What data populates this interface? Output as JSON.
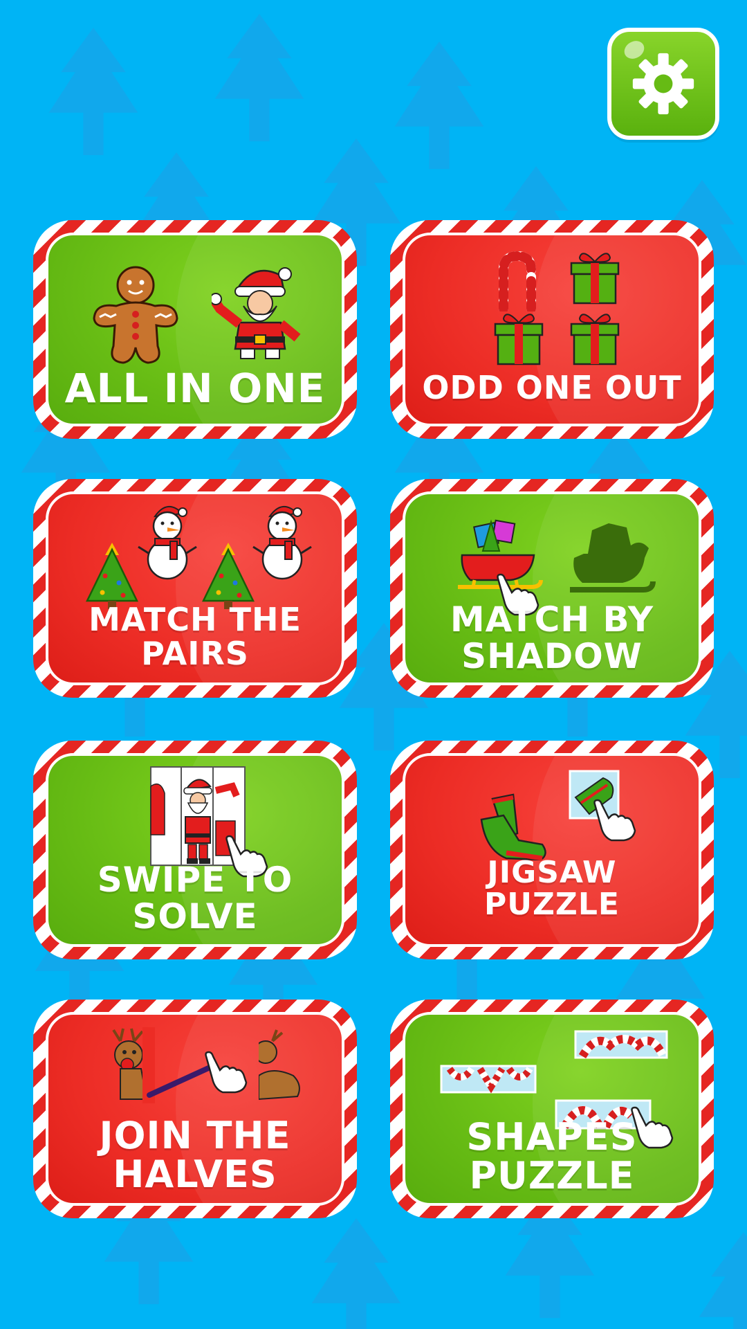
{
  "settings": {
    "icon": "gear-icon",
    "color": "#66bb14"
  },
  "modes": [
    {
      "id": "all-in-one",
      "label": "ALL IN ONE",
      "color": "green",
      "icons": [
        "gingerbread-man-icon",
        "santa-icon"
      ]
    },
    {
      "id": "odd-one-out",
      "label": "ODD ONE OUT",
      "color": "red",
      "icons": [
        "candy-cane-icon",
        "gift-box-icon"
      ]
    },
    {
      "id": "match-the-pairs",
      "label": "MATCH THE PAIRS",
      "color": "red",
      "icons": [
        "christmas-tree-icon",
        "snowman-icon"
      ]
    },
    {
      "id": "match-by-shadow",
      "label": "MATCH BY SHADOW",
      "color": "green",
      "icons": [
        "sleigh-icon",
        "sleigh-shadow-icon",
        "pointing-hand-icon"
      ]
    },
    {
      "id": "swipe-to-solve",
      "label": "SWIPE TO SOLVE",
      "color": "green",
      "icons": [
        "santa-tiles-icon",
        "pointing-hand-icon"
      ]
    },
    {
      "id": "jigsaw-puzzle",
      "label": "JIGSAW PUZZLE",
      "color": "red",
      "icons": [
        "mitten-icon",
        "puzzle-piece-icon",
        "pointing-hand-icon"
      ]
    },
    {
      "id": "join-the-halves",
      "label": "JOIN THE HALVES",
      "color": "red",
      "icons": [
        "reindeer-half-icon",
        "pointing-hand-icon"
      ]
    },
    {
      "id": "shapes-puzzle",
      "label": "SHAPES PUZZLE",
      "color": "green",
      "icons": [
        "candy-cane-shapes-icon",
        "pointing-hand-icon"
      ]
    }
  ],
  "colors": {
    "background": "#00b4f5",
    "green": "#66bb14",
    "red": "#ec2c25",
    "stripe": "#e52622"
  }
}
